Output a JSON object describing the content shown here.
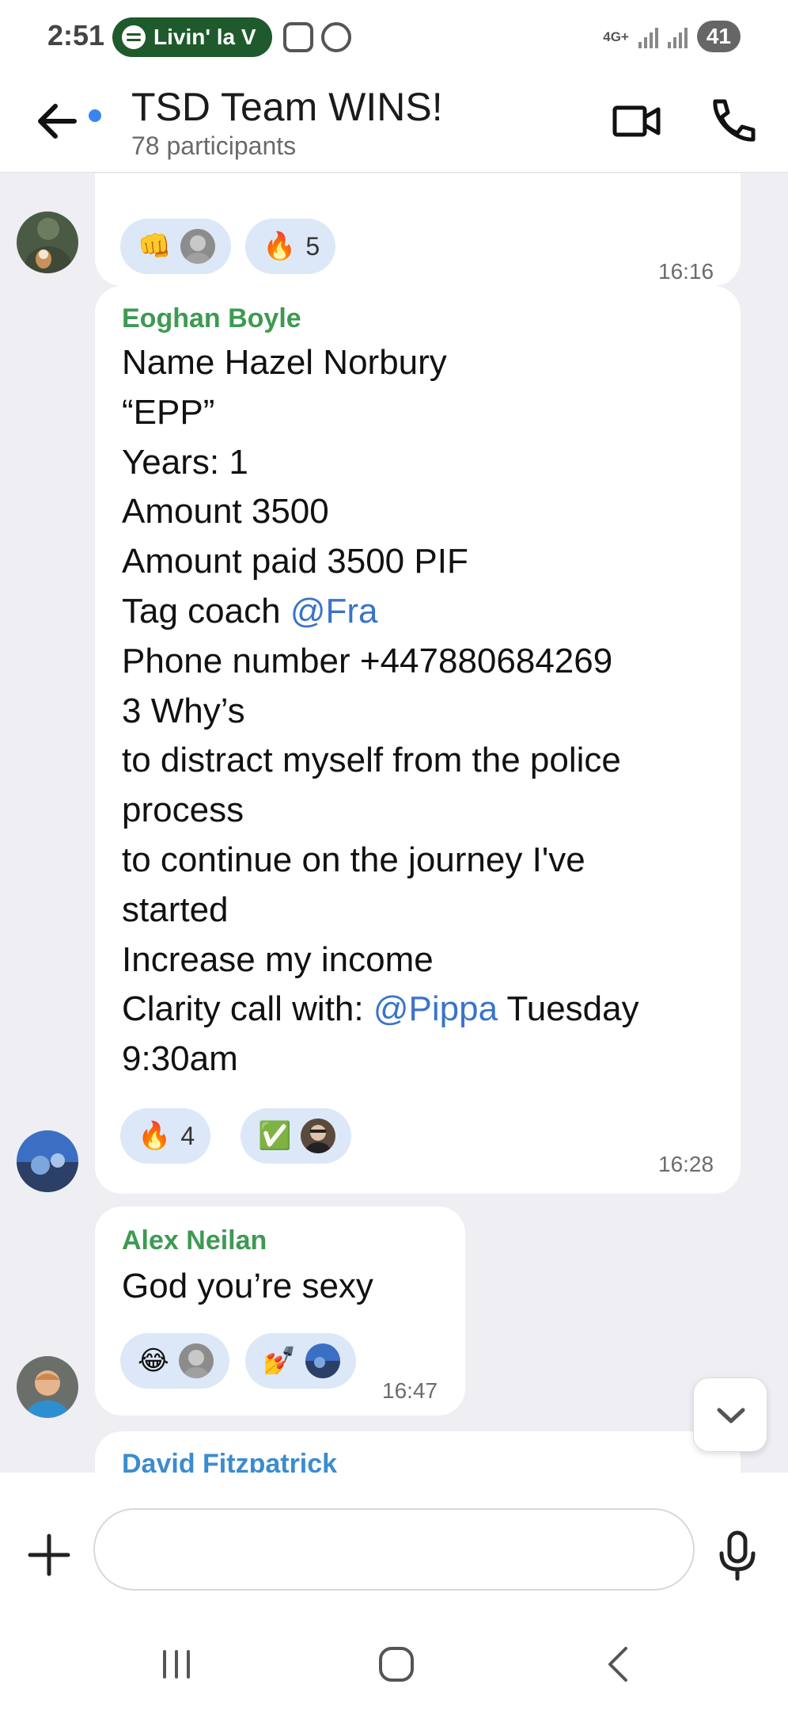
{
  "status_bar": {
    "time": "2:51",
    "now_playing": "Livin' la V",
    "network": "4G+",
    "battery": "41"
  },
  "header": {
    "title": "TSD Team WINS!",
    "subtitle": "78 participants"
  },
  "messages": [
    {
      "reactions": [
        {
          "emoji": "👊",
          "count": ""
        },
        {
          "emoji": "🔥",
          "count": "5"
        }
      ],
      "time": "16:16"
    },
    {
      "sender": "Eoghan Boyle",
      "lines": {
        "l1": "Name Hazel Norbury",
        "l2": "“EPP”",
        "l3": "Years: 1",
        "l4": "Amount 3500",
        "l5": "Amount paid 3500 PIF",
        "l6_prefix": "Tag coach ",
        "l6_mention": "@Fra",
        "l7": "Phone number +447880684269",
        "l8": "3 Why’s",
        "l9": "to distract myself from the police",
        "l10": "process",
        "l11": "to continue on the journey I've",
        "l12": "started",
        "l13": "Increase my income",
        "l14_prefix": "Clarity call with: ",
        "l14_mention": "@Pippa",
        "l14_suffix": " Tuesday",
        "l15": "9:30am"
      },
      "reactions": [
        {
          "emoji": "🔥",
          "count": "4"
        },
        {
          "emoji": "✅",
          "count": ""
        }
      ],
      "time": "16:28"
    },
    {
      "sender": "Alex Neilan",
      "text": "God you’re sexy",
      "reactions": [
        {
          "emoji": "😂",
          "count": ""
        },
        {
          "emoji": "💅",
          "count": ""
        }
      ],
      "time": "16:47"
    },
    {
      "sender": "David Fitzpatrick"
    }
  ],
  "composer": {
    "placeholder": ""
  },
  "icons": {
    "back": "arrow-left-icon",
    "video": "video-camera-icon",
    "call": "phone-icon",
    "attach": "plus-icon",
    "mic": "microphone-icon",
    "scroll": "chevron-down-icon",
    "nav_recents": "recents-icon",
    "nav_home": "home-icon",
    "nav_back": "back-chevron-icon"
  },
  "colors": {
    "sender_green": "#3d9a52",
    "sender_blue": "#3b8ccf",
    "mention": "#3a74c9",
    "reaction_bg": "#dce8f7",
    "chat_bg": "#eeeef3",
    "unread_dot": "#3a86f0"
  }
}
